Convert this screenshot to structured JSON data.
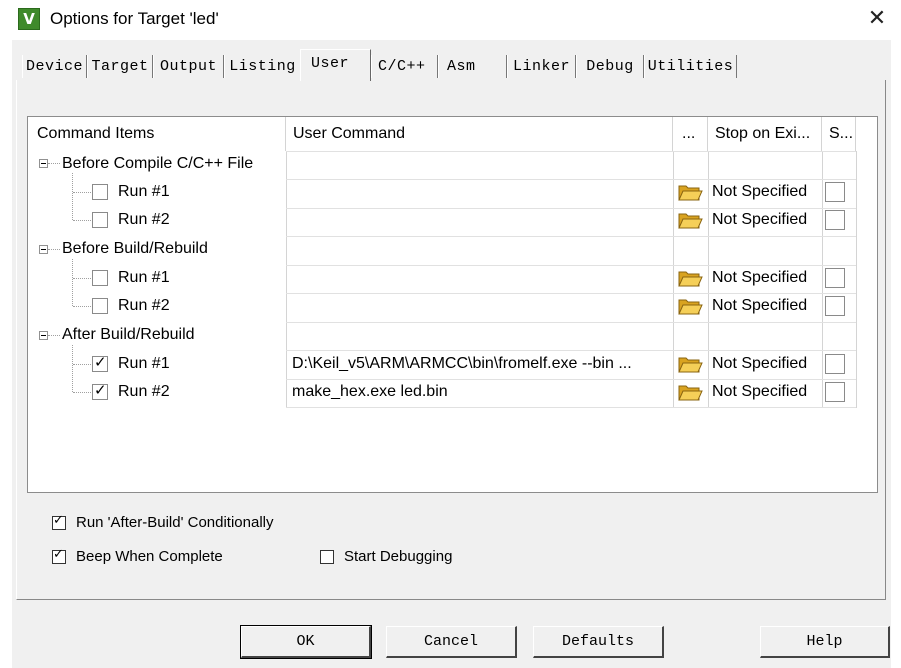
{
  "window": {
    "title": "Options for Target 'led'",
    "icon_letter": "V",
    "close_glyph": "✕"
  },
  "tabs": [
    {
      "label": "Device"
    },
    {
      "label": "Target"
    },
    {
      "label": "Output"
    },
    {
      "label": "Listing"
    },
    {
      "label": "User",
      "active": true
    },
    {
      "label": "C/C++"
    },
    {
      "label": "Asm"
    },
    {
      "label": "Linker"
    },
    {
      "label": "Debug"
    },
    {
      "label": "Utilities"
    }
  ],
  "grid": {
    "headers": {
      "items": "Command Items",
      "command": "User Command",
      "browse": "...",
      "stop": "Stop on Exi...",
      "s": "S..."
    },
    "groups": [
      {
        "label": "Before Compile C/C++ File",
        "rows": [
          {
            "label": "Run #1",
            "checked": false,
            "command": "",
            "stop": "Not Specified"
          },
          {
            "label": "Run #2",
            "checked": false,
            "command": "",
            "stop": "Not Specified"
          }
        ]
      },
      {
        "label": "Before Build/Rebuild",
        "rows": [
          {
            "label": "Run #1",
            "checked": false,
            "command": "",
            "stop": "Not Specified"
          },
          {
            "label": "Run #2",
            "checked": false,
            "command": "",
            "stop": "Not Specified"
          }
        ]
      },
      {
        "label": "After Build/Rebuild",
        "rows": [
          {
            "label": "Run #1",
            "checked": true,
            "command": "D:\\Keil_v5\\ARM\\ARMCC\\bin\\fromelf.exe --bin  ...",
            "stop": "Not Specified"
          },
          {
            "label": "Run #2",
            "checked": true,
            "command": "make_hex.exe led.bin",
            "stop": "Not Specified"
          }
        ]
      }
    ]
  },
  "options": {
    "run_after_build": {
      "label": "Run 'After-Build' Conditionally",
      "checked": true
    },
    "beep": {
      "label": "Beep When Complete",
      "checked": true
    },
    "start_debugging": {
      "label": "Start Debugging",
      "checked": false
    }
  },
  "buttons": {
    "ok": "OK",
    "cancel": "Cancel",
    "defaults": "Defaults",
    "help": "Help"
  },
  "colors": {
    "folder": "#e8b830",
    "tree_line": "#a0a0a0"
  },
  "icons": {
    "folder": "folder-open-icon",
    "expander": "collapse-minus-icon"
  }
}
